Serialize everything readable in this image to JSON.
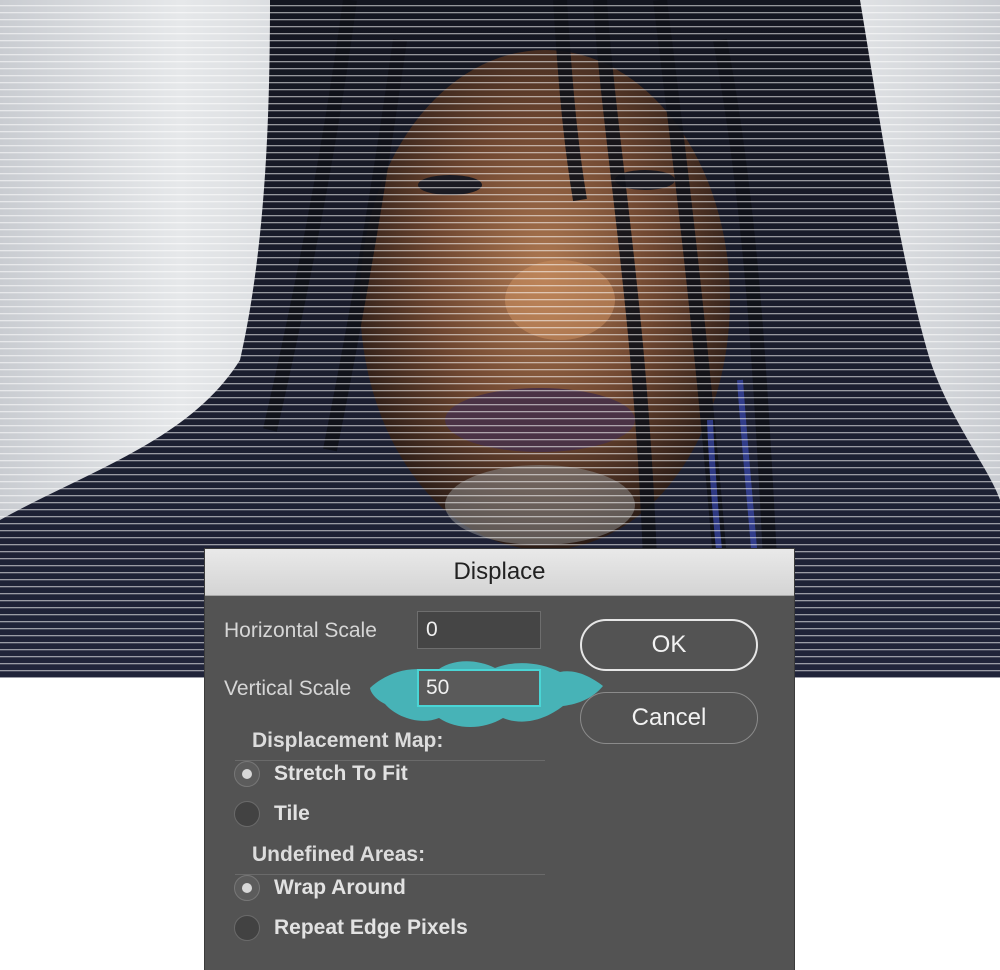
{
  "dialog": {
    "title": "Displace",
    "horizontal_scale": {
      "label": "Horizontal Scale",
      "value": "0"
    },
    "vertical_scale": {
      "label": "Vertical Scale",
      "value": "50"
    },
    "ok_label": "OK",
    "cancel_label": "Cancel",
    "displacement_map": {
      "title": "Displacement Map:",
      "options": [
        {
          "label": "Stretch To Fit",
          "selected": true
        },
        {
          "label": "Tile",
          "selected": false
        }
      ]
    },
    "undefined_areas": {
      "title": "Undefined Areas:",
      "options": [
        {
          "label": "Wrap Around",
          "selected": true
        },
        {
          "label": "Repeat Edge Pixels",
          "selected": false
        }
      ]
    }
  },
  "colors": {
    "dialog_bg": "#535353",
    "titlebar_bg": "#d9d9d9",
    "focus_accent": "#4ad5d5",
    "highlight_brush": "#47bcc0"
  }
}
